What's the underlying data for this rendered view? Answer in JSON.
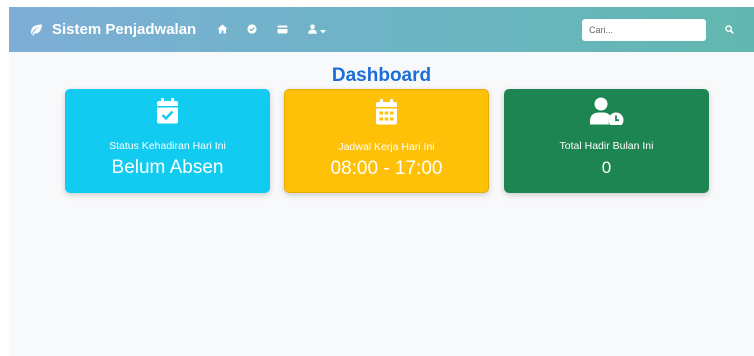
{
  "navbar": {
    "brand": "Sistem Penjadwalan",
    "brand_icon": "leaf-icon",
    "nav_icons": [
      "home-icon",
      "check-circle-icon",
      "id-card-icon",
      "user-icon",
      "caret-down-icon"
    ],
    "search": {
      "placeholder": "Cari...",
      "value": ""
    },
    "search_icon": "search-icon"
  },
  "main": {
    "title": "Dashboard",
    "cards": [
      {
        "label": "Status Kehadiran Hari Ini",
        "value": "Belum Absen",
        "icon": "calendar-check-icon",
        "color": "#12cbf0"
      },
      {
        "label": "Jadwal Kerja Hari Ini",
        "value": "08:00 - 17:00",
        "icon": "calendar-icon",
        "color": "#ffc107"
      },
      {
        "label": "Total Hadir Bulan Ini",
        "value": "0",
        "icon": "user-clock-icon",
        "color": "#1d8552"
      }
    ]
  }
}
